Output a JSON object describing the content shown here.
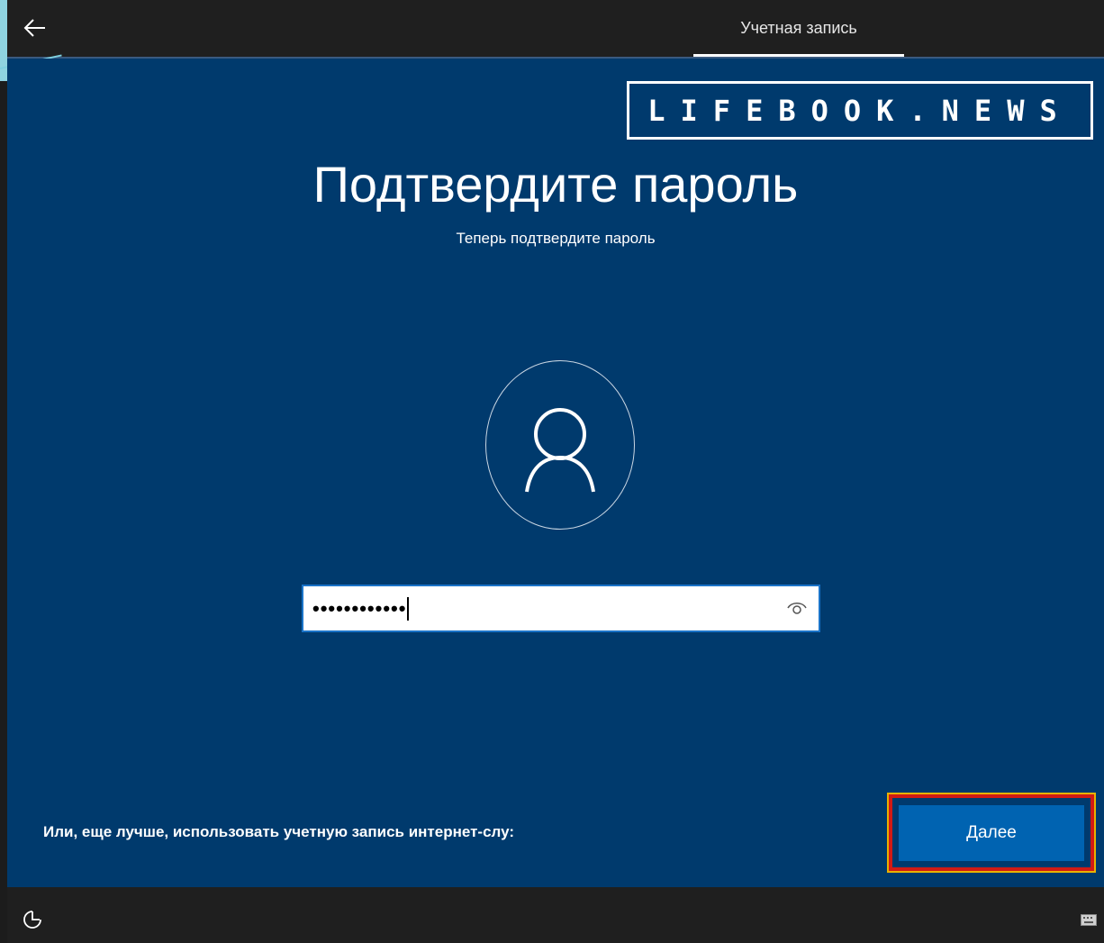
{
  "header": {
    "step_label": "Учетная запись"
  },
  "watermark": {
    "text": "LIFEBOOK.NEWS"
  },
  "main": {
    "title": "Подтвердите пароль",
    "subtitle": "Теперь подтвердите пароль"
  },
  "password_field": {
    "masked_value": "••••••••••••"
  },
  "footer": {
    "online_account_link": "Или, еще лучше, использовать учетную запись интернет-слу:",
    "next_button": "Далее"
  },
  "icons": {
    "back": "back-arrow-icon",
    "user": "user-icon",
    "reveal": "eye-icon",
    "accessibility": "accessibility-icon",
    "keyboard": "keyboard-icon"
  },
  "colors": {
    "background": "#003a6d",
    "bar": "#1f1f1f",
    "accent": "#0063b1",
    "highlight": "#d21a14"
  }
}
